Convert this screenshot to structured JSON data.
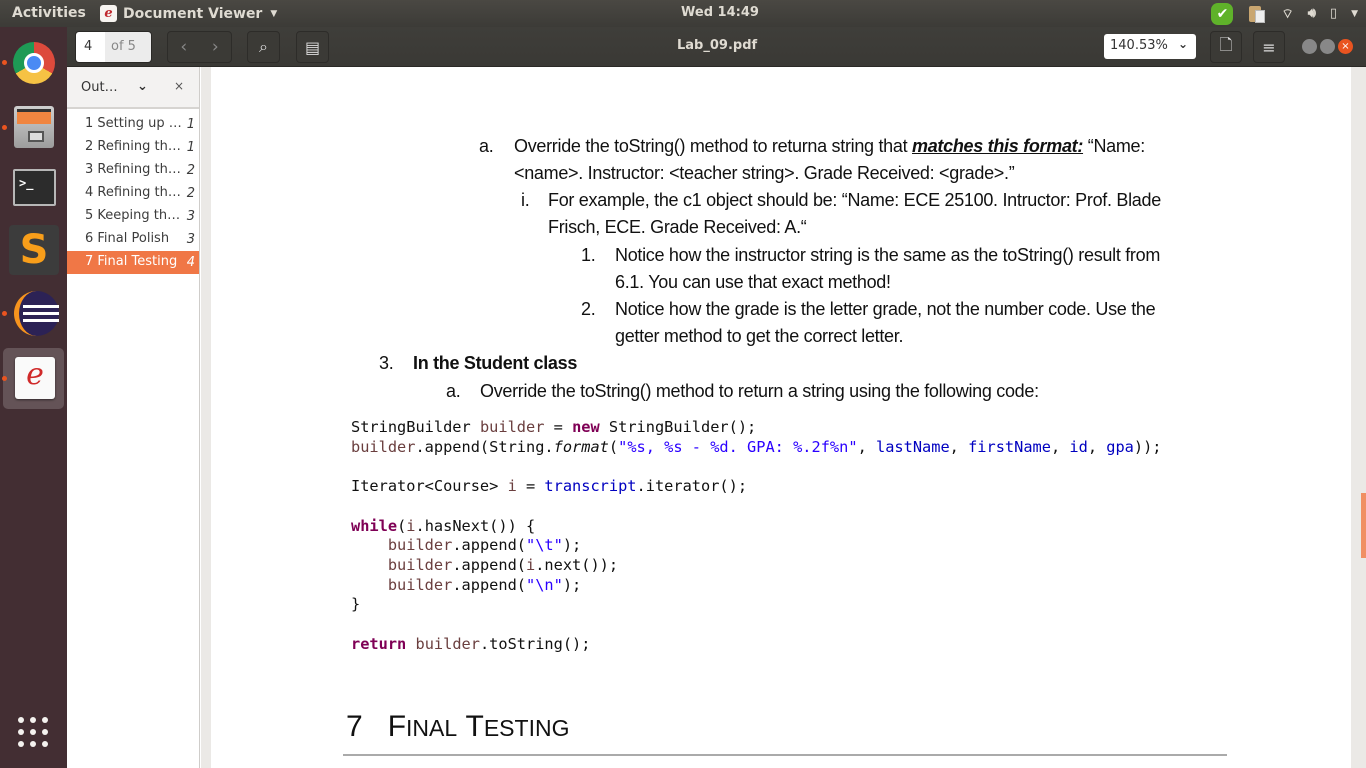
{
  "topbar": {
    "activities": "Activities",
    "app_name": "Document Viewer",
    "app_icon": "evince-icon",
    "clock": "Wed 14:49",
    "tray": [
      "check-icon",
      "clipboard-icon",
      "wifi-icon",
      "volume-icon",
      "battery-icon",
      "chevron-down-icon"
    ]
  },
  "dock": {
    "items": [
      {
        "name": "Google Chrome",
        "running": true
      },
      {
        "name": "Files",
        "running": true
      },
      {
        "name": "Terminal",
        "running": false
      },
      {
        "name": "Sublime Text",
        "running": false
      },
      {
        "name": "Eclipse",
        "running": true
      },
      {
        "name": "Document Viewer",
        "running": true,
        "active": true
      }
    ],
    "show_apps": "Show Applications"
  },
  "header": {
    "current_page": "4",
    "total_pages": "of 5",
    "title": "Lab_09.pdf",
    "zoom": "140.53%"
  },
  "sidebar": {
    "mode": "Out…",
    "items": [
      {
        "label": "1 Setting up …",
        "page": "1"
      },
      {
        "label": "2 Refining th…",
        "page": "1"
      },
      {
        "label": "3 Refining th…",
        "page": "2"
      },
      {
        "label": "4 Refining th…",
        "page": "2"
      },
      {
        "label": "5 Keeping th…",
        "page": "3"
      },
      {
        "label": "6 Final Polish",
        "page": "3"
      },
      {
        "label": "7 Final Testing",
        "page": "4",
        "selected": true
      }
    ]
  },
  "document": {
    "item_a1": {
      "marker": "a.",
      "pre": "Override the toString() method to returna  string that ",
      "emph": "matches this format:",
      "post": " “Name:",
      "line2": "<name>. Instructor: <teacher string>. Grade Received: <grade>.”"
    },
    "item_i": {
      "marker": "i.",
      "line1": "For example, the c1 object should be: “Name: ECE 25100. Intructor: Prof. Blade",
      "line2": "Frisch, ECE. Grade Received: A.“"
    },
    "item_1": {
      "marker": "1.",
      "line1": "Notice how the instructor string is the same as the toString() result from",
      "line2": "6.1. You can use that exact method!"
    },
    "item_2": {
      "marker": "2.",
      "line1": "Notice how the grade is the letter grade, not the number code. Use the",
      "line2": "getter method to get the correct letter."
    },
    "item_3": {
      "marker": "3.",
      "label": "In the Student class"
    },
    "item_a2": {
      "marker": "a.",
      "text": "Override the toString() method to return a string using the following code:"
    },
    "code": {
      "l1_type": "StringBuilder",
      "l1_var": "builder",
      "l1_eq": " = ",
      "l1_new": "new",
      "l1_rest": " StringBuilder();",
      "l2_var": "builder",
      "l2_a": ".append(String.",
      "l2_fmt": "format",
      "l2_b": "(",
      "l2_str": "\"%s, %s - %d. GPA: %.2f%n\"",
      "l2_c": ", ",
      "l2_f1": "lastName",
      "l2_f2": "firstName",
      "l2_f3": "id",
      "l2_f4": "gpa",
      "l2_end": "));",
      "l3_a": "Iterator<Course> ",
      "l3_var": "i",
      "l3_b": " = ",
      "l3_fld": "transcript",
      "l3_c": ".iterator();",
      "l4_kw": "while",
      "l4_a": "(",
      "l4_var": "i",
      "l4_b": ".hasNext()) {",
      "l5_var": "builder",
      "l5_a": ".append(",
      "l5_str": "\"\\t\"",
      "l5_b": ");",
      "l6_var": "builder",
      "l6_a": ".append(",
      "l6_var2": "i",
      "l6_b": ".next());",
      "l7_var": "builder",
      "l7_a": ".append(",
      "l7_str": "\"\\n\"",
      "l7_b": ");",
      "l8": "}",
      "l9_kw": "return",
      "l9_var": "builder",
      "l9_a": ".toString();"
    },
    "heading": {
      "number": "7",
      "first_cap": "F",
      "first_rest": "INAL",
      "second_cap": "T",
      "second_rest": "ESTING"
    }
  }
}
